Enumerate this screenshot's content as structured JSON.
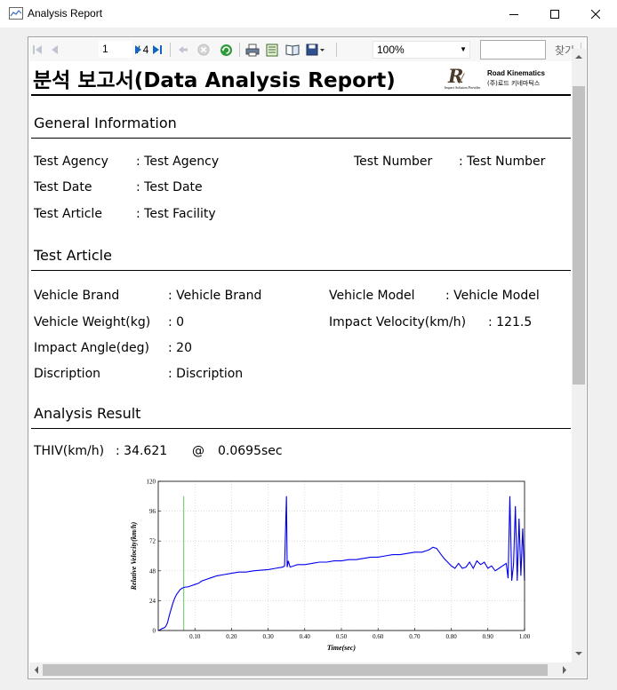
{
  "window": {
    "title": "Analysis Report",
    "app_icon": "chart-window-icon",
    "minimize_icon": "minimize-icon",
    "maximize_icon": "maximize-icon",
    "close_icon": "close-icon"
  },
  "toolbar": {
    "page_current": "1",
    "page_sep_total": "/ 4",
    "zoom": "100%",
    "search_value": "",
    "find_label": "찾기",
    "icons": [
      "first-page-icon",
      "prev-page-icon",
      "next-page-icon",
      "last-page-icon",
      "back-icon",
      "stop-icon",
      "refresh-icon",
      "print-icon",
      "page-setup-icon",
      "print-layout-icon",
      "export-icon"
    ]
  },
  "report": {
    "title": "분석 보고서(Data Analysis Report)",
    "logo": {
      "brand": "Road Kinematics",
      "korean": "(주)로드 키네마틱스",
      "tagline": "Impact Solution Provider"
    },
    "general": {
      "heading": "General Information",
      "agency_label": "Test Agency",
      "agency_value": ": Test Agency",
      "number_label": "Test Number",
      "number_value": ": Test Number",
      "date_label": "Test Date",
      "date_value": ": Test Date",
      "article_label": "Test Article",
      "article_value": ": Test Facility"
    },
    "article": {
      "heading": "Test Article",
      "brand_label": "Vehicle Brand",
      "brand_value": ": Vehicle Brand",
      "model_label": "Vehicle Model",
      "model_value": ": Vehicle Model",
      "weight_label": "Vehicle Weight(kg)",
      "weight_value": ": 0",
      "velocity_label": "Impact Velocity(km/h)",
      "velocity_value": ": 121.5",
      "angle_label": "Impact Angle(deg)",
      "angle_value": ": 20",
      "discription_label": "Discription",
      "discription_value": ": Discription"
    },
    "result": {
      "heading": "Analysis Result",
      "thiv_label": "THIV(km/h)",
      "thiv_value": ": 34.621",
      "at": "@",
      "time_value": "0.0695sec"
    }
  },
  "chart_data": {
    "type": "line",
    "xlabel": "Time(sec)",
    "ylabel": "Relative Velocity(km/h)",
    "xlim": [
      0,
      1.0
    ],
    "ylim": [
      0,
      120
    ],
    "xticks": [
      "0.10",
      "0.20",
      "0.30",
      "0.40",
      "0.50",
      "0.60",
      "0.70",
      "0.80",
      "0.90",
      "1.00"
    ],
    "yticks": [
      "0",
      "24",
      "48",
      "72",
      "96",
      "120"
    ],
    "grid": true,
    "colors": {
      "series": "#0000ee",
      "marker": "#80cc80",
      "grid": "#c8c8c8"
    },
    "marker_x": 0.0695,
    "series": [
      {
        "x": [
          0.0,
          0.005,
          0.01,
          0.015,
          0.02,
          0.025,
          0.03,
          0.035,
          0.04,
          0.045,
          0.05,
          0.055,
          0.06,
          0.065,
          0.0695,
          0.075,
          0.08,
          0.09,
          0.1,
          0.11,
          0.12,
          0.13,
          0.14,
          0.15,
          0.16,
          0.18,
          0.2,
          0.22,
          0.24,
          0.26,
          0.28,
          0.3,
          0.32,
          0.34,
          0.345,
          0.35,
          0.352,
          0.355,
          0.36,
          0.38,
          0.4,
          0.42,
          0.44,
          0.46,
          0.48,
          0.5,
          0.52,
          0.54,
          0.56,
          0.58,
          0.6,
          0.62,
          0.64,
          0.66,
          0.68,
          0.7,
          0.72,
          0.74,
          0.75,
          0.76,
          0.77,
          0.78,
          0.79,
          0.8,
          0.81,
          0.82,
          0.83,
          0.84,
          0.85,
          0.86,
          0.87,
          0.88,
          0.89,
          0.9,
          0.91,
          0.92,
          0.93,
          0.94,
          0.95,
          0.955,
          0.96,
          0.965,
          0.97,
          0.975,
          0.98,
          0.985,
          0.99,
          0.995,
          1.0
        ],
        "y": [
          0,
          0.5,
          1.5,
          2,
          3,
          6,
          12,
          17,
          22,
          26,
          29,
          31,
          33,
          34,
          34.6,
          35,
          35,
          36,
          37,
          38,
          40,
          41,
          42,
          43,
          44,
          45,
          46,
          47,
          47,
          48,
          48.5,
          49,
          50,
          51,
          52,
          108,
          51,
          56,
          51,
          53,
          53,
          54,
          55,
          55,
          56,
          56,
          57,
          57,
          58,
          59,
          59,
          60,
          61,
          61,
          62,
          63,
          63,
          65,
          67,
          66,
          62,
          58,
          55,
          52,
          50,
          54,
          50,
          51,
          55,
          50,
          56,
          53,
          55,
          50,
          52,
          48,
          50,
          52,
          54,
          42,
          108,
          40,
          53,
          100,
          40,
          90,
          44,
          82,
          40
        ]
      }
    ]
  }
}
